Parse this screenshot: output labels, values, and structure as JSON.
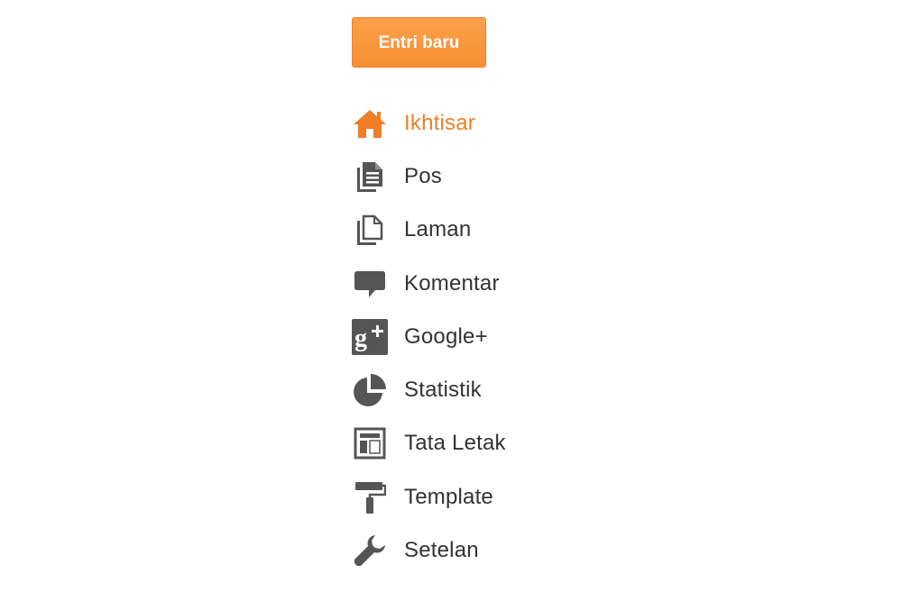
{
  "new_post_button": {
    "label": "Entri baru",
    "color": "#f68f32"
  },
  "nav": {
    "active_color": "#f07e26",
    "icon_color": "#555555",
    "items": [
      {
        "label": "Ikhtisar",
        "icon": "home-icon",
        "active": true
      },
      {
        "label": "Pos",
        "icon": "posts-icon",
        "active": false
      },
      {
        "label": "Laman",
        "icon": "pages-icon",
        "active": false
      },
      {
        "label": "Komentar",
        "icon": "comment-icon",
        "active": false
      },
      {
        "label": "Google+",
        "icon": "google-plus-icon",
        "active": false
      },
      {
        "label": "Statistik",
        "icon": "pie-chart-icon",
        "active": false
      },
      {
        "label": "Tata Letak",
        "icon": "layout-icon",
        "active": false
      },
      {
        "label": "Template",
        "icon": "paint-roller-icon",
        "active": false
      },
      {
        "label": "Setelan",
        "icon": "wrench-icon",
        "active": false
      }
    ]
  }
}
